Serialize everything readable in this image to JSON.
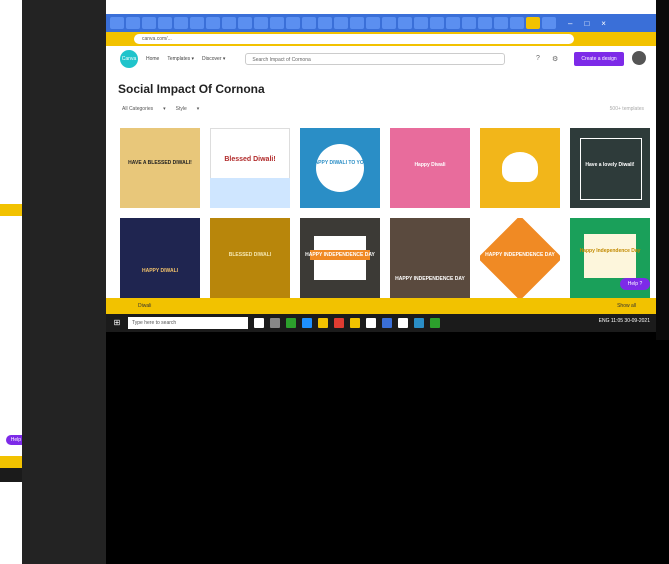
{
  "browser": {
    "window_controls": [
      "–",
      "□",
      "×"
    ],
    "url": "canva.com/..."
  },
  "canva": {
    "logo": "Canva",
    "nav": [
      "Home",
      "Templates ▾",
      "Discover ▾"
    ],
    "search_placeholder": "Search Impact of Cornona",
    "create_button": "Create a design",
    "page_title": "Social Impact Of Cornona",
    "filters": [
      "All Categories",
      "▾",
      "Style",
      "▾"
    ],
    "result_count": "500+ templates",
    "cards": [
      {
        "text": "HAVE A BLESSED DIWALI!",
        "bg": "#e8c77a"
      },
      {
        "text": "Blessed Diwali!",
        "bg": "#ffffff"
      },
      {
        "text": "HAPPY DIWALI TO YOU!",
        "bg": "#2a8ec6"
      },
      {
        "text": "Happy Diwali",
        "bg": "#e86c9c"
      },
      {
        "text": "",
        "bg": "#f2b61a"
      },
      {
        "text": "Have a lovely Diwali!",
        "bg": "#2e3b3a"
      },
      {
        "text": "HAPPY DIWALI",
        "bg": "#1f2550"
      },
      {
        "text": "BLESSED DIWALI",
        "bg": "#b8860b"
      },
      {
        "text": "HAPPY INDEPENDENCE DAY",
        "bg": "#3c3a36"
      },
      {
        "text": "HAPPY INDEPENDENCE DAY",
        "bg": "#5a4a3e"
      },
      {
        "text": "HAPPY INDEPENDENCE DAY",
        "bg": "#f08a24"
      },
      {
        "text": "Happy Independence Day",
        "bg": "#1aa05a"
      }
    ],
    "help_button": "Help ?",
    "bottom_left": "Diwali",
    "bottom_right": "Show all"
  },
  "taskbar": {
    "search_placeholder": "Type here to search",
    "tray_text": "ENG",
    "time": "11:05",
    "date": "30-09-2021"
  },
  "left_window": {
    "help_button": "Help ?"
  }
}
